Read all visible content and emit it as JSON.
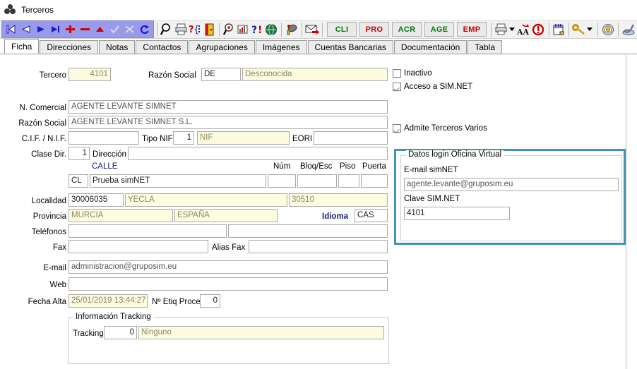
{
  "window": {
    "title": "Terceros",
    "icon": "molecule-icon"
  },
  "toolbar": {
    "nav_icons": [
      {
        "name": "first-record-icon",
        "label": "Primero"
      },
      {
        "name": "previous-record-icon",
        "label": "Anterior"
      },
      {
        "name": "next-record-icon",
        "label": "Siguiente"
      },
      {
        "name": "last-record-icon",
        "label": "Último"
      },
      {
        "name": "add-record-icon",
        "label": "Insertar"
      },
      {
        "name": "delete-record-icon",
        "label": "Borrar"
      },
      {
        "name": "edit-record-icon",
        "label": "Modificar"
      },
      {
        "name": "confirm-icon",
        "label": "Aceptar"
      },
      {
        "name": "cancel-icon",
        "label": "Cancelar"
      },
      {
        "name": "refresh-icon",
        "label": "Refrescar"
      }
    ],
    "action_icons": [
      {
        "name": "search-icon",
        "label": "Buscar"
      },
      {
        "name": "print-icon",
        "label": "Imprimir"
      },
      {
        "name": "query-icon",
        "label": "Consulta"
      },
      {
        "name": "exit-door-icon",
        "label": "Salir"
      },
      {
        "name": "zoom-in-icon",
        "label": "Zoom"
      },
      {
        "name": "chart-icon",
        "label": "Gráfico"
      },
      {
        "name": "help-icon",
        "label": "Ayuda"
      },
      {
        "name": "globe-icon",
        "label": "Web"
      },
      {
        "name": "phone-icon",
        "label": "Teléfono"
      },
      {
        "name": "mail-send-icon",
        "label": "Enviar correo"
      }
    ],
    "module_buttons": [
      {
        "label": "CLI",
        "color": "#007a00"
      },
      {
        "label": "PRO",
        "color": "#cc0000"
      },
      {
        "label": "ACR",
        "color": "#007a00"
      },
      {
        "label": "AGE",
        "color": "#007a00"
      },
      {
        "label": "EMP",
        "color": "#cc0000"
      }
    ],
    "right_icons": [
      {
        "name": "print-preview-icon",
        "label": "Vista previa"
      },
      {
        "name": "font-icon",
        "label": "Fuente"
      },
      {
        "name": "alert-clock-icon",
        "label": "Avisos"
      },
      {
        "name": "notebook-icon",
        "label": "Notas"
      },
      {
        "name": "key-icon",
        "label": "Permisos"
      },
      {
        "name": "target-icon",
        "label": "Localizar"
      },
      {
        "name": "brush-icon",
        "label": "Estilo"
      }
    ]
  },
  "tabs": [
    {
      "label": "Ficha",
      "active": true
    },
    {
      "label": "Direcciones",
      "active": false
    },
    {
      "label": "Notas",
      "active": false
    },
    {
      "label": "Contactos",
      "active": false
    },
    {
      "label": "Agrupaciones",
      "active": false
    },
    {
      "label": "Imágenes",
      "active": false
    },
    {
      "label": "Cuentas Bancarias",
      "active": false
    },
    {
      "label": "Documentación",
      "active": false
    },
    {
      "label": "Tabla",
      "active": false
    }
  ],
  "form": {
    "tercero_label": "Tercero",
    "tercero_value": "4101",
    "razon_social_top_label": "Razón Social",
    "razon_social_code": "DE",
    "razon_social_desc": "Desconocida",
    "n_comercial_label": "N. Comercial",
    "n_comercial_value": "AGENTE LEVANTE SIMNET",
    "razon_social_label": "Razón Social",
    "razon_social_value": "AGENTE LEVANTE SIMNET S.L.",
    "cif_label": "C.I.F. / N.I.F.",
    "cif_value": "",
    "tipo_nif_label": "Tipo NIF:",
    "tipo_nif_value": "1",
    "nif_placeholder": "NIF",
    "eori_label": "EORI",
    "eori_value": "",
    "clase_dir_label": "Clase Dir.",
    "clase_dir_value": "1",
    "direccion_label": "Dirección",
    "direccion_value": "",
    "via_type_header": "CALLE",
    "num_header": "Núm",
    "bloq_header": "Bloq/Esc",
    "piso_header": "Piso",
    "puerta_header": "Puerta",
    "via_code": "CL",
    "via_name": "Prueba simNET",
    "num_value": "",
    "bloq_value": "",
    "piso_value": "",
    "puerta_value": "",
    "localidad_label": "Localidad",
    "localidad_code": "30006035",
    "localidad_name": "YECLA",
    "cp_value": "30510",
    "provincia_label": "Provincia",
    "provincia_value": "MURCIA",
    "pais_value": "ESPAÑA",
    "idioma_label": "Idioma",
    "idioma_value": "CAS",
    "telefonos_label": "Teléfonos",
    "telefono1_value": "",
    "telefono2_value": "",
    "fax_label": "Fax",
    "fax_value": "",
    "alias_fax_label": "Alias Fax",
    "alias_fax_value": "",
    "email_label": "E-mail",
    "email_value": "administracion@gruposim.eu",
    "web_label": "Web",
    "web_value": "",
    "fecha_alta_label": "Fecha Alta",
    "fecha_alta_value": "25/01/2019 13:44:27",
    "etiq_proce_label": "Nº Etiq Proce",
    "etiq_proce_value": "0"
  },
  "checkboxes": [
    {
      "label": "Inactivo",
      "checked": false
    },
    {
      "label": "Acceso a SIM.NET",
      "checked": true
    },
    {
      "label": "Admite Terceros Varios",
      "checked": true
    }
  ],
  "tracking": {
    "caption": "Información Tracking",
    "label": "Tracking",
    "code": "0",
    "name": "Ninguno"
  },
  "login_panel": {
    "caption": "Datos login Oficina Virtual",
    "email_label": "E-mail simNET",
    "email_value": "agente.levante@gruposim.eu",
    "clave_label": "Clave SIM.NET",
    "clave_value": "4101",
    "border_color": "#3f94b8"
  }
}
